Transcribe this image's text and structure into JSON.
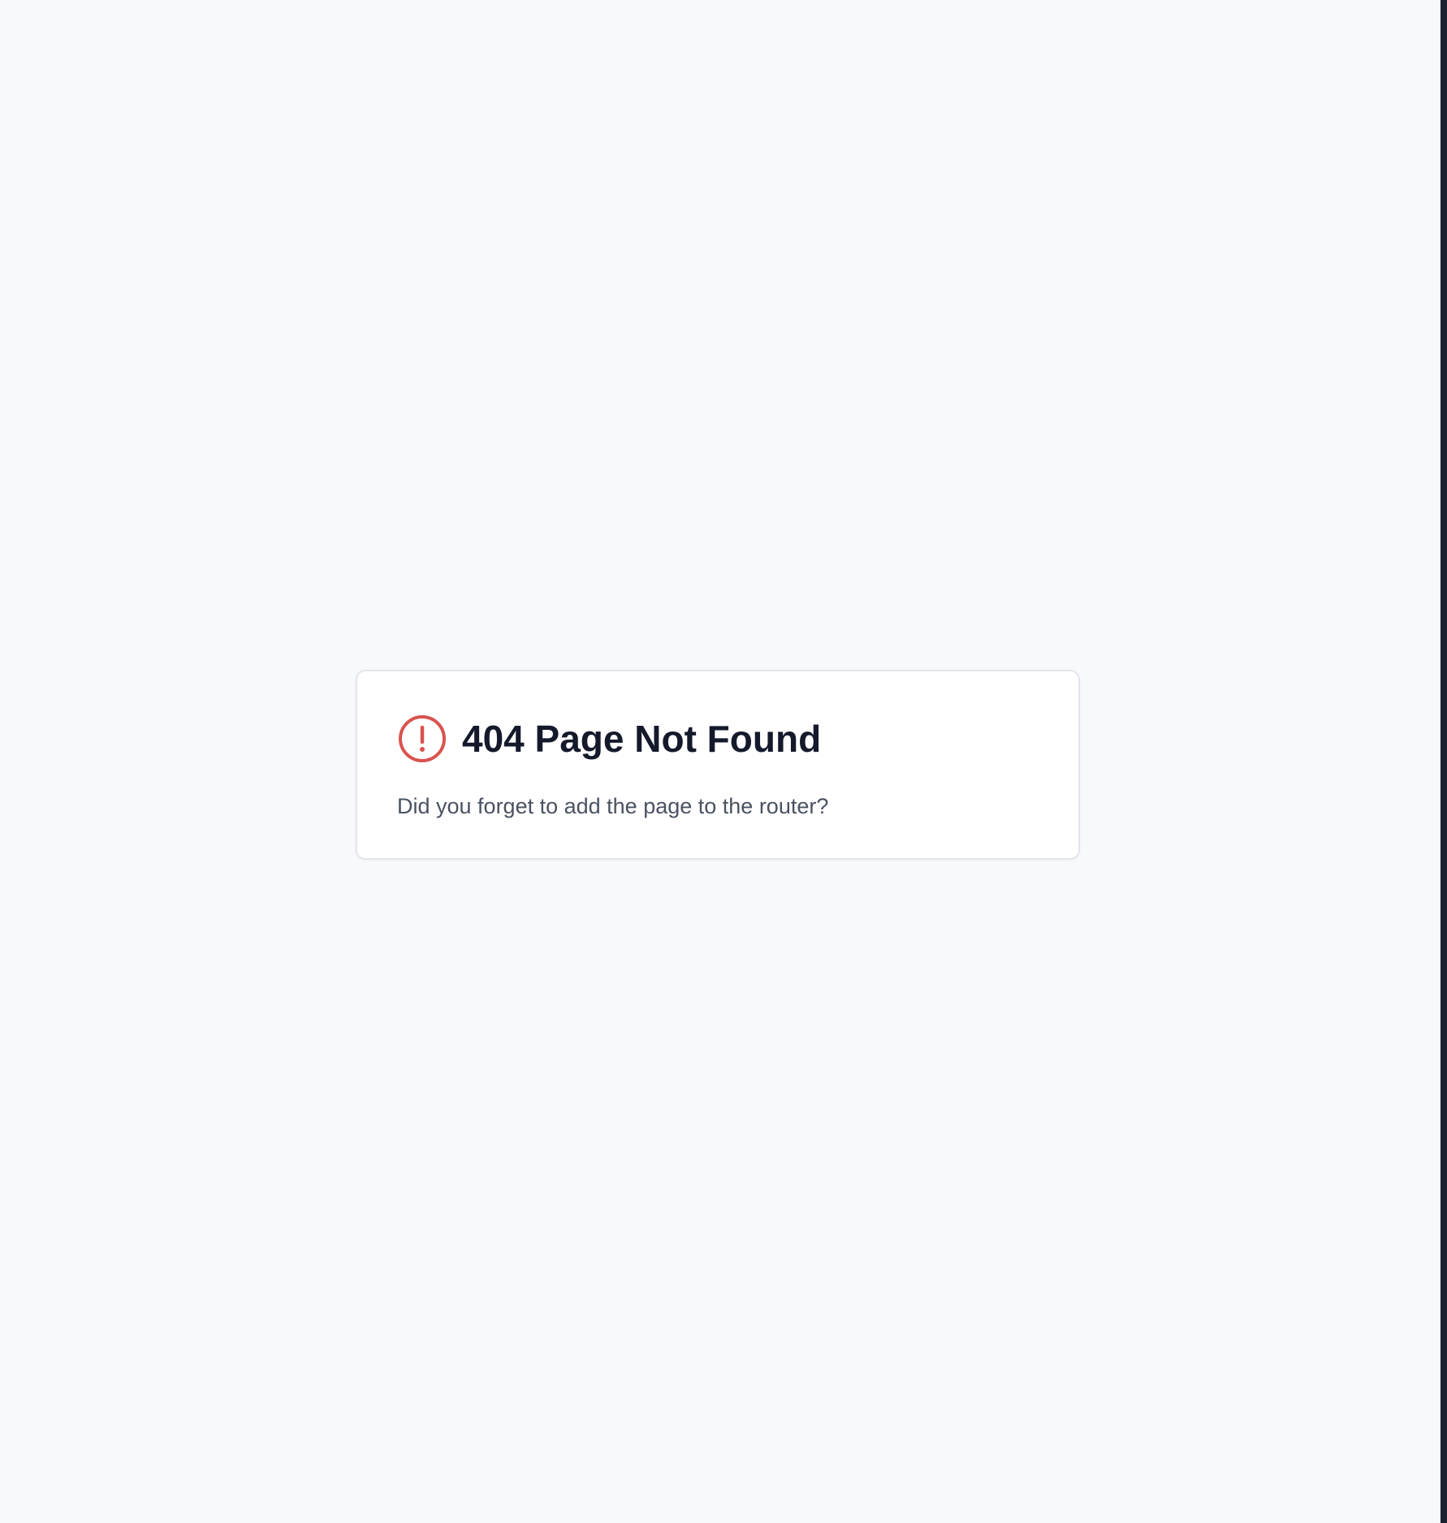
{
  "error_card": {
    "icon": "alert-circle-icon",
    "title": "404 Page Not Found",
    "message": "Did you forget to add the page to the router?"
  },
  "colors": {
    "background": "#F8F9FB",
    "card_background": "#FFFFFF",
    "card_border": "#E4E6EB",
    "icon": "#D9534F",
    "title": "#141A2B",
    "message": "#4A5262"
  }
}
